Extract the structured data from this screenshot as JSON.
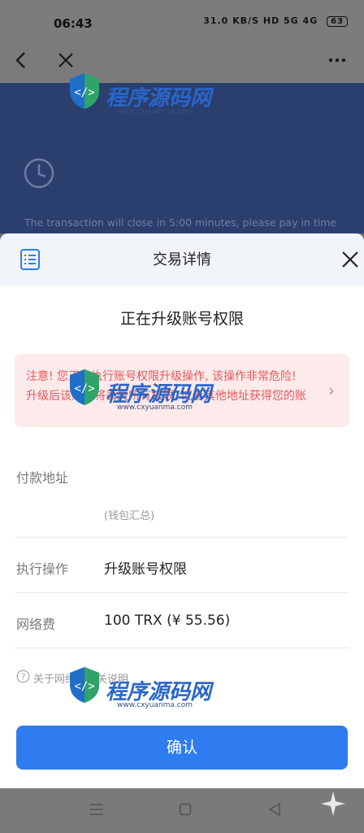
{
  "status_bar": {
    "time": "06:43",
    "network_speed": "31.0 KB/S",
    "signal_text": "HD 5G 4G",
    "battery": "63"
  },
  "background": {
    "notice": "The transaction will close in 5:00  minutes, please pay in time"
  },
  "sheet": {
    "title": "交易详情",
    "subtitle": "正在升级账号权限",
    "warning": "注意! 您正在执行账号权限升级操作, 该操作非常危险! 升级后该账户将丢失所有权限, 或者其他地址获得您的账户权限",
    "fields": {
      "payment_address_label": "付款地址",
      "payment_address_hint": "(钱包汇总)",
      "operation_label": "执行操作",
      "operation_value": "升级账号权限",
      "fee_label": "网络费",
      "fee_value": "100 TRX (¥ 55.56)"
    },
    "help_text": "关于网络费相关说明",
    "confirm_label": "确认"
  },
  "watermark": {
    "title": "程序源码网",
    "url": "www.cxyuanma.com"
  },
  "colors": {
    "accent": "#2f7cf0",
    "warning_text": "#e8585c",
    "warning_bg": "#fdeaea"
  }
}
